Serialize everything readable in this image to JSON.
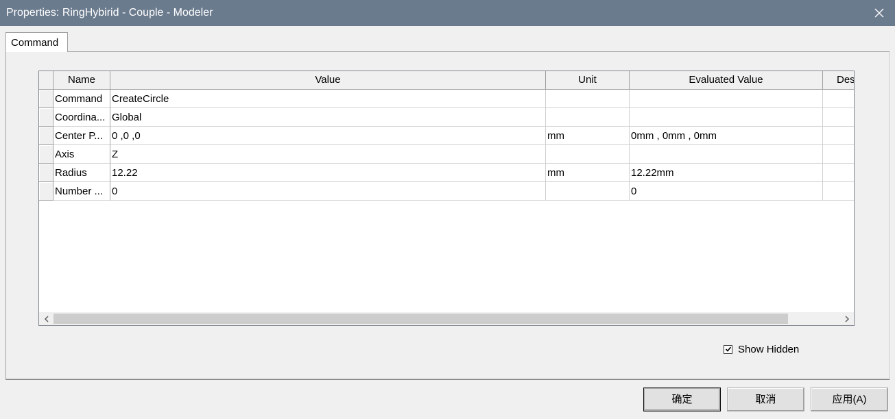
{
  "window": {
    "title": "Properties: RingHybirid - Couple - Modeler"
  },
  "tabs": [
    {
      "label": "Command",
      "active": true
    }
  ],
  "grid": {
    "columns": [
      "Name",
      "Value",
      "Unit",
      "Evaluated Value",
      "Des"
    ],
    "rows": [
      {
        "name": "Command",
        "value": "CreateCircle",
        "unit": "",
        "evaluated": ""
      },
      {
        "name": "Coordina...",
        "value": "Global",
        "unit": "",
        "evaluated": ""
      },
      {
        "name": "Center P...",
        "value": "0 ,0 ,0",
        "unit": "mm",
        "evaluated": "0mm , 0mm , 0mm"
      },
      {
        "name": "Axis",
        "value": "Z",
        "unit": "",
        "evaluated": ""
      },
      {
        "name": "Radius",
        "value": "12.22",
        "unit": "mm",
        "evaluated": "12.22mm"
      },
      {
        "name": "Number ...",
        "value": "0",
        "unit": "",
        "evaluated": "0"
      }
    ]
  },
  "show_hidden": {
    "label": "Show Hidden",
    "checked": true
  },
  "buttons": {
    "ok": "确定",
    "cancel": "取消",
    "apply": "应用(A)"
  },
  "colors": {
    "titlebar": "#6b7b8e",
    "background": "#f0f0f0"
  }
}
